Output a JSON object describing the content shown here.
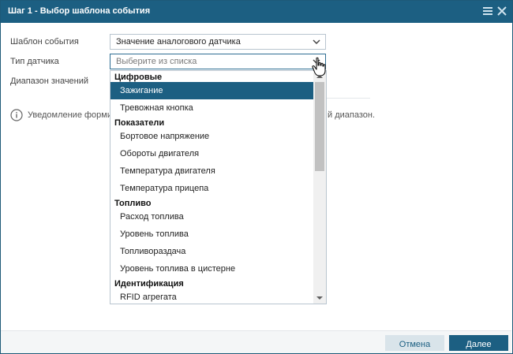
{
  "window": {
    "title": "Шаг 1 - Выбор шаблона события",
    "icons": [
      "menu-icon",
      "close-icon"
    ]
  },
  "form": {
    "template_label": "Шаблон события",
    "template_value": "Значение аналогового датчика",
    "sensor_type_label": "Тип датчика",
    "sensor_type_placeholder": "Выберите из списка",
    "range_label": "Диапазон значений"
  },
  "notice": {
    "text_start": "Уведомление форми",
    "text_end": "й диапазон."
  },
  "dropdown": {
    "groups": [
      {
        "label": "Цифровые",
        "items": [
          "Зажигание",
          "Тревожная кнопка"
        ]
      },
      {
        "label": "Показатели",
        "items": [
          "Бортовое напряжение",
          "Обороты двигателя",
          "Температура двигателя",
          "Температура прицепа"
        ]
      },
      {
        "label": "Топливо",
        "items": [
          "Расход топлива",
          "Уровень топлива",
          "Топливораздача",
          "Уровень топлива в цистерне"
        ]
      },
      {
        "label": "Идентификация",
        "items": [
          "RFID агрегата"
        ]
      }
    ],
    "selected": "Зажигание"
  },
  "footer": {
    "cancel_label": "Отмена",
    "next_label": "Далее"
  },
  "colors": {
    "primary": "#1c5f82",
    "cancel_bg": "#d9e4ea"
  }
}
